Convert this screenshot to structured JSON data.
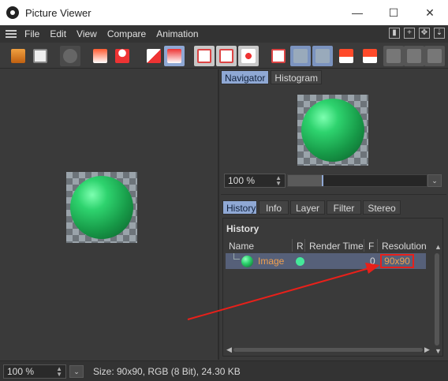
{
  "window": {
    "title": "Picture Viewer",
    "minimize_glyph": "—",
    "maximize_glyph": "☐",
    "close_glyph": "✕"
  },
  "menu": [
    "File",
    "Edit",
    "View",
    "Compare",
    "Animation"
  ],
  "toolbar_icons": [
    "open-icon",
    "save-icon",
    "animation-icon",
    "render-region-icon",
    "render-person-icon",
    "copy-layer-icon",
    "channel-icon",
    "display-a-icon",
    "display-b-icon",
    "display-ab-icon",
    "ab-compare-icon",
    "ab-split-icon",
    "ab-diff-icon",
    "set-a-icon",
    "set-b-icon",
    "film-a-icon",
    "film-b-icon",
    "film-c-icon"
  ],
  "navigator": {
    "tabs": [
      "Navigator",
      "Histogram"
    ],
    "active_tab": "Navigator",
    "zoom_value": "100 %",
    "zoom_level": 0.25
  },
  "info_tabs": [
    "History",
    "Info",
    "Layer",
    "Filter",
    "Stereo"
  ],
  "history": {
    "title": "History",
    "columns": [
      "Name",
      "R",
      "Render Time",
      "F",
      "Resolution"
    ],
    "rows": [
      {
        "name": "Image",
        "render_time": "",
        "frame": "0",
        "resolution": "90x90",
        "status_color": "#45e89a"
      }
    ]
  },
  "status": {
    "zoom_value": "100 %",
    "text": "Size: 90x90, RGB (8 Bit), 24.30 KB"
  },
  "colors": {
    "accent": "#8fa8d4",
    "highlight_row": "#566079",
    "annotation": "#e8201a",
    "name_text": "#f0a050"
  }
}
